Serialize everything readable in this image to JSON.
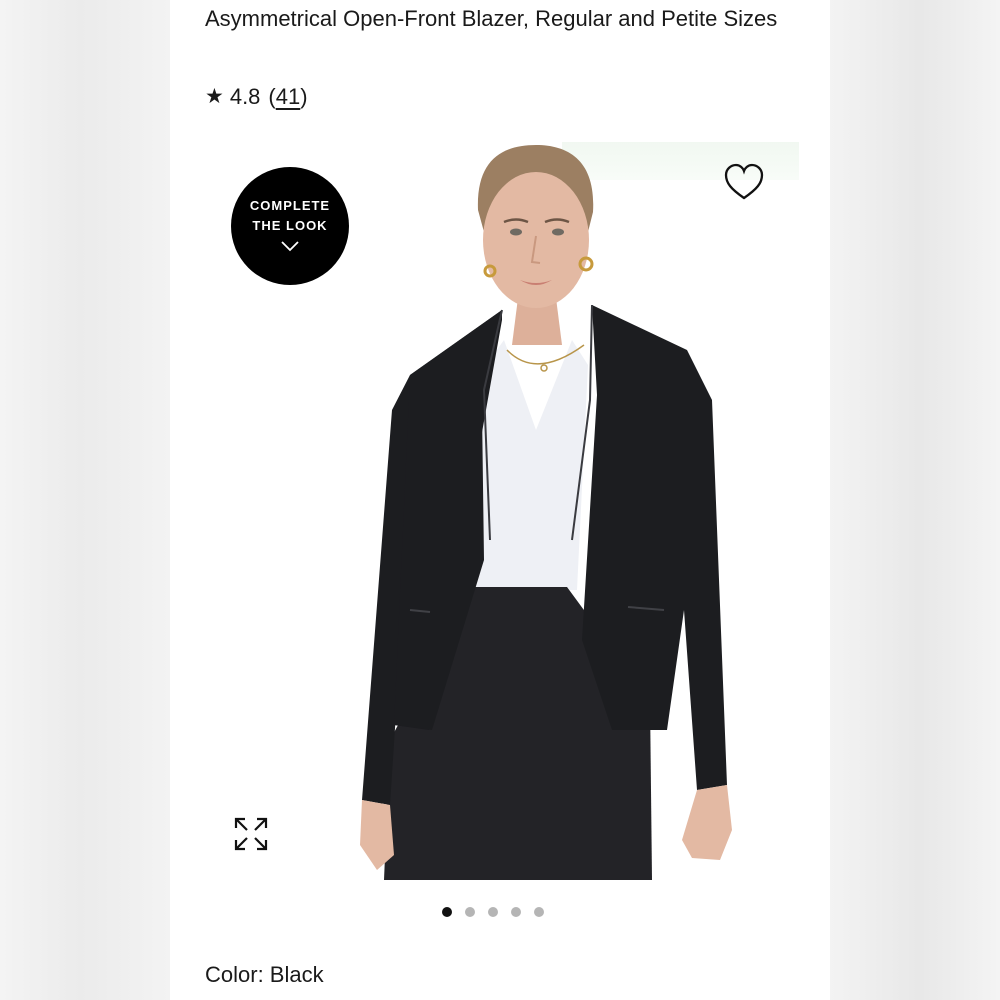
{
  "product": {
    "title": "Asymmetrical Open-Front Blazer, Regular and Petite Sizes",
    "rating": {
      "star_icon": "star-icon",
      "value": "4.8",
      "count": "41",
      "open_paren": "(",
      "close_paren": ")"
    },
    "color_label": "Color: Black"
  },
  "gallery": {
    "badge_line1": "COMPLETE",
    "badge_line2": "THE LOOK",
    "badge_icon": "chevron-down-icon",
    "favorite_icon": "heart-icon",
    "expand_icon": "expand-icon",
    "dot_count": 5,
    "active_index": 0
  },
  "colors": {
    "text": "#1a1a1a",
    "badge_bg": "#000000",
    "blazer": "#1c1d20",
    "blouse": "#eef0f5",
    "skin": "#e3b9a3"
  }
}
